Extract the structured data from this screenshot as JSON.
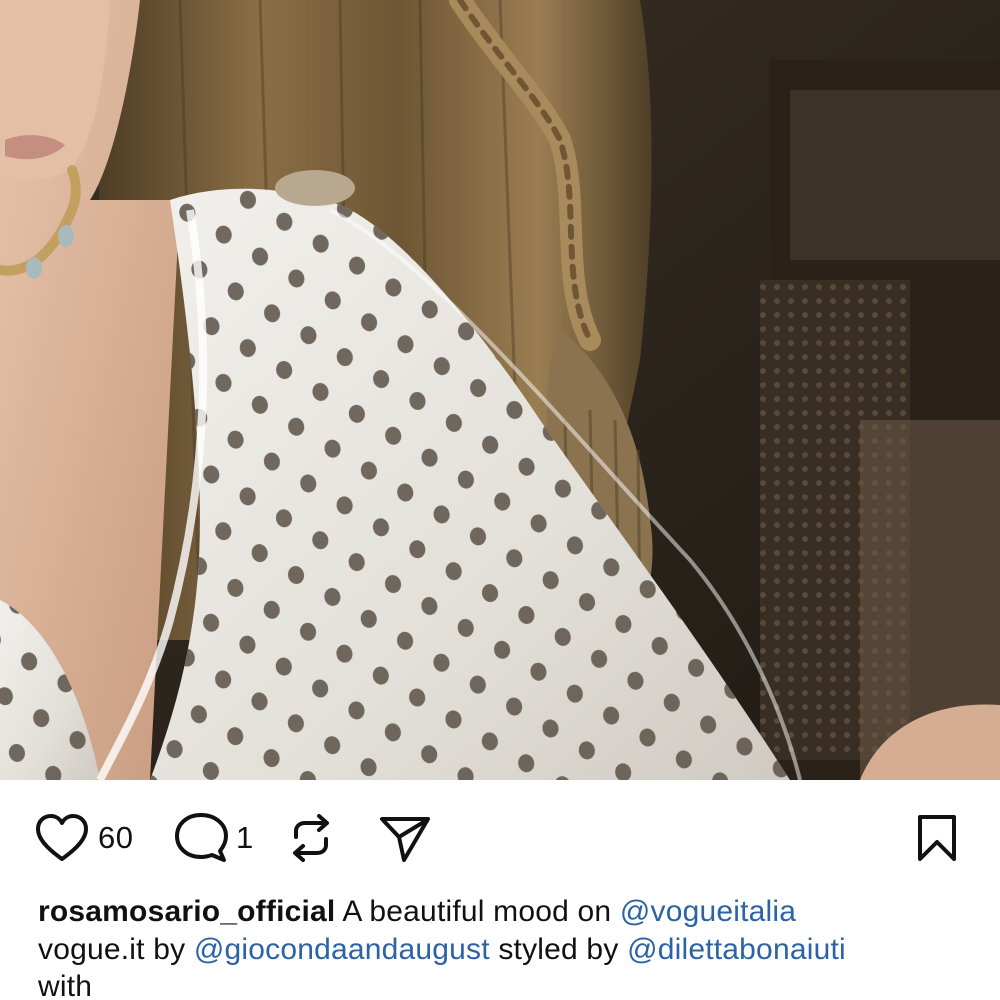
{
  "post": {
    "photo": {
      "alt": "",
      "colors": {
        "curtain": "#6e5634",
        "wall": "#2e261d",
        "dress": "#eceae6",
        "dots": "#5b5147",
        "skin": "#d9b39a"
      }
    },
    "actions": {
      "like_icon": "heart-icon",
      "like_count": "60",
      "comment_icon": "comment-bubble-icon",
      "comment_count": "1",
      "repost_icon": "repost-icon",
      "share_icon": "paper-plane-icon",
      "save_icon": "bookmark-icon"
    },
    "caption": {
      "username": "rosamosario_official",
      "text_1": " A beautiful mood on ",
      "mention_1": "@vogueitalia",
      "text_2": "vogue.it by ",
      "mention_2": "@giocondaandaugust",
      "text_3": " styled by ",
      "mention_3": "@dilettabonaiuti",
      "text_4": "with"
    }
  },
  "colors": {
    "text": "#111111",
    "mention": "#2b63a6",
    "background": "#ffffff"
  }
}
